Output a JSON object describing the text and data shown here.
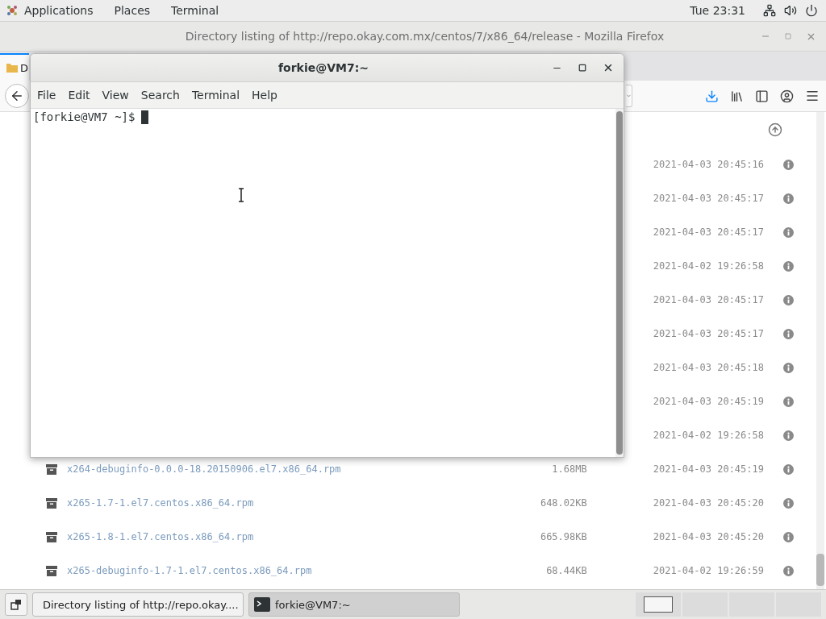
{
  "top_bar": {
    "menus": [
      "Applications",
      "Places",
      "Terminal"
    ],
    "clock": "Tue 23:31"
  },
  "browser": {
    "title": "Directory listing of http://repo.okay.com.mx/centos/7/x86_64/release - Mozilla Firefox",
    "tab": {
      "label": "D"
    },
    "rows": [
      {
        "date": "2021-04-03 20:45:16"
      },
      {
        "date": "2021-04-03 20:45:17"
      },
      {
        "date": "2021-04-03 20:45:17"
      },
      {
        "date": "2021-04-02 19:26:58"
      },
      {
        "date": "2021-04-03 20:45:17"
      },
      {
        "date": "2021-04-03 20:45:17"
      },
      {
        "date": "2021-04-03 20:45:18"
      },
      {
        "date": "2021-04-03 20:45:19"
      },
      {
        "date": "2021-04-02 19:26:58"
      },
      {
        "name": "x264-debuginfo-0.0.0-18.20150906.el7.x86_64.rpm",
        "size": "1.68MB",
        "date": "2021-04-03 20:45:19"
      },
      {
        "name": "x265-1.7-1.el7.centos.x86_64.rpm",
        "size": "648.02KB",
        "date": "2021-04-03 20:45:20"
      },
      {
        "name": "x265-1.8-1.el7.centos.x86_64.rpm",
        "size": "665.98KB",
        "date": "2021-04-03 20:45:20"
      },
      {
        "name": "x265-debuginfo-1.7-1.el7.centos.x86_64.rpm",
        "size": "68.44KB",
        "date": "2021-04-02 19:26:59"
      }
    ]
  },
  "terminal": {
    "title": "forkie@VM7:~",
    "menu": [
      "File",
      "Edit",
      "View",
      "Search",
      "Terminal",
      "Help"
    ],
    "prompt": "[forkie@VM7 ~]$"
  },
  "taskbar": {
    "tasks": [
      {
        "kind": "browser",
        "label": "Directory listing of http://repo.okay....",
        "selected": false
      },
      {
        "kind": "terminal",
        "label": "forkie@VM7:~",
        "selected": true
      }
    ],
    "workspaces": [
      {
        "selected": true
      },
      {
        "selected": false
      },
      {
        "selected": false
      },
      {
        "selected": false
      }
    ]
  }
}
